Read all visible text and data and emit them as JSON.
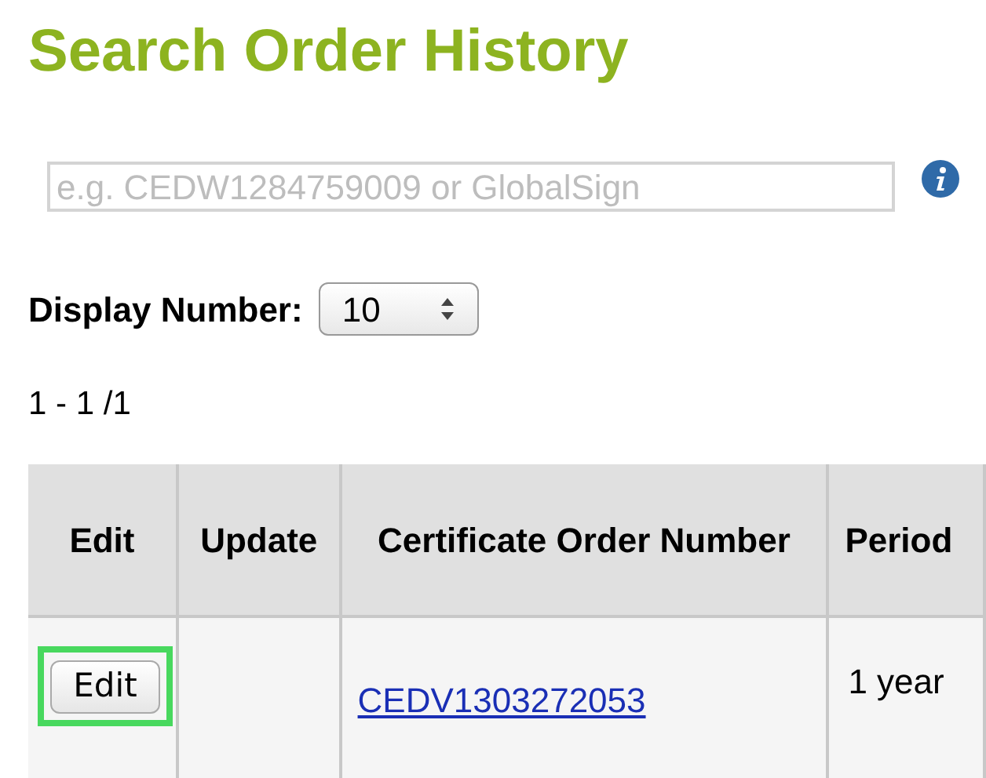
{
  "title": "Search Order History",
  "search": {
    "placeholder": "e.g. CEDW1284759009 or GlobalSign"
  },
  "display_number": {
    "label": "Display Number:",
    "value": "10"
  },
  "pagination": "1 - 1 /1",
  "table": {
    "columns": [
      "Edit",
      "Update",
      "Certificate Order Number",
      "Period"
    ],
    "rows": [
      {
        "edit_button": {
          "label": "Edit",
          "highlighted": true
        },
        "order_number": "CEDV1303272053",
        "period": "1 year"
      }
    ]
  }
}
